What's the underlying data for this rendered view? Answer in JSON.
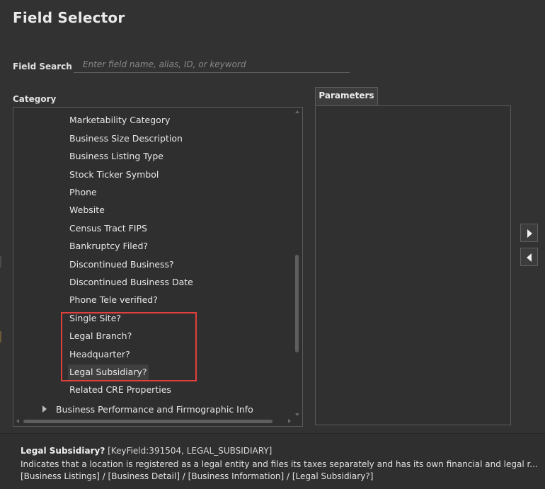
{
  "window": {
    "title": "Field Selector"
  },
  "search": {
    "label": "Field Search",
    "placeholder": "Enter field name, alias, ID, or keyword",
    "value": ""
  },
  "category": {
    "label": "Category",
    "items": [
      {
        "label": "Marketability Category"
      },
      {
        "label": "Business Size Description"
      },
      {
        "label": "Business Listing Type"
      },
      {
        "label": "Stock Ticker Symbol"
      },
      {
        "label": "Phone"
      },
      {
        "label": "Website"
      },
      {
        "label": "Census Tract FIPS"
      },
      {
        "label": "Bankruptcy Filed?"
      },
      {
        "label": "Discontinued Business?"
      },
      {
        "label": "Discontinued Business Date"
      },
      {
        "label": "Phone Tele verified?"
      },
      {
        "label": "Single Site?"
      },
      {
        "label": "Legal Branch?"
      },
      {
        "label": "Headquarter?"
      },
      {
        "label": "Legal Subsidiary?"
      },
      {
        "label": "Related CRE Properties"
      }
    ],
    "selected": "Legal Subsidiary?",
    "group": {
      "label": "Business Performance and Firmographic Info",
      "expanded": false
    }
  },
  "parameters": {
    "tab_label": "Parameters"
  },
  "buttons": {
    "add_icon": "triangle-right-icon",
    "remove_icon": "triangle-left-icon"
  },
  "highlight_color": "#e0403c",
  "footer": {
    "field_name": "Legal Subsidiary?",
    "key_field": "[KeyField:391504, LEGAL_SUBSIDIARY]",
    "description": "Indicates that a location is registered as a legal entity and files its taxes separately and has its own financial and legal r...",
    "path": "[Business Listings] / [Business Detail] / [Business Information] / [Legal Subsidiary?]"
  }
}
